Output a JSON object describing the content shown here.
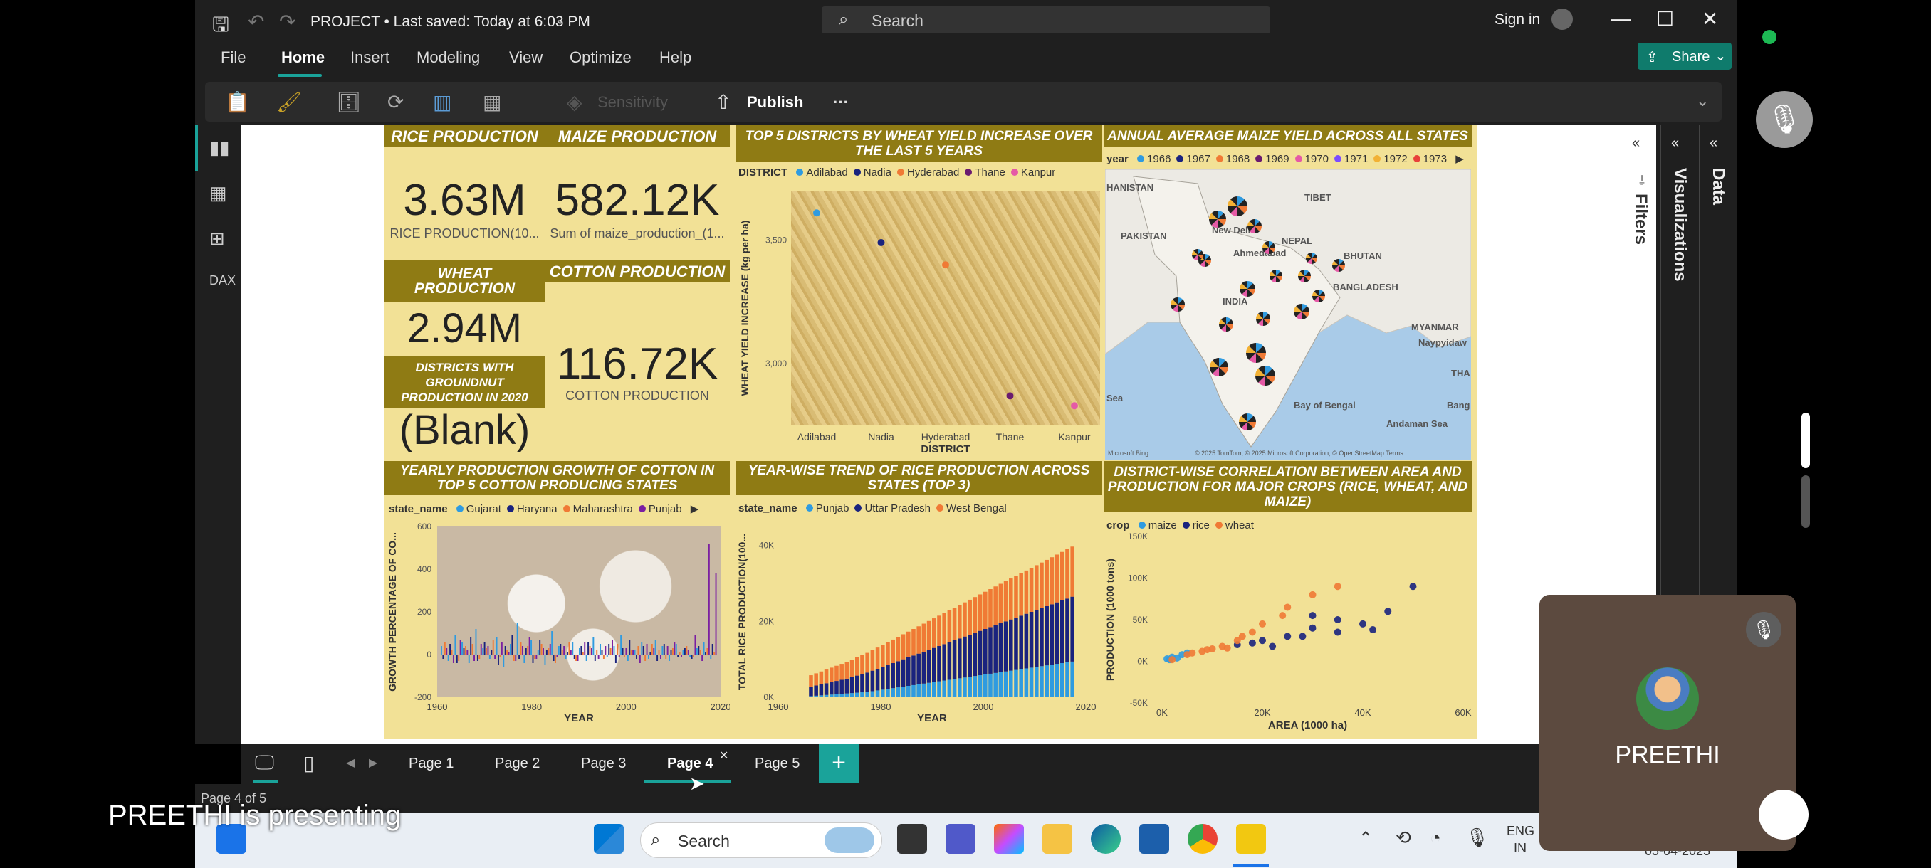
{
  "window": {
    "title": "PROJECT • Last saved: Today at 6:03 PM",
    "search_placeholder": "Search",
    "sign_in": "Sign in"
  },
  "menu": [
    "File",
    "Home",
    "Insert",
    "Modeling",
    "View",
    "Optimize",
    "Help"
  ],
  "share_label": "Share",
  "ribbon": {
    "sensitivity": "Sensitivity",
    "publish": "Publish",
    "more": "···"
  },
  "side_panes": {
    "filters": "Filters",
    "visualizations": "Visualizations",
    "data": "Data"
  },
  "cards": {
    "rice": {
      "title": "RICE PRODUCTION",
      "value": "3.63M",
      "label": "RICE PRODUCTION(10..."
    },
    "maize": {
      "title": "MAIZE PRODUCTION",
      "value": "582.12K",
      "label": "Sum of maize_production_(1..."
    },
    "wheat": {
      "title": "WHEAT PRODUCTION",
      "value": "2.94M"
    },
    "cotton": {
      "title": "COTTON PRODUCTION",
      "value": "116.72K",
      "label": "COTTON PRODUCTION"
    },
    "groundnut": {
      "title": "DISTRICTS WITH GROUNDNUT PRODUCTION IN 2020",
      "value": "(Blank)"
    }
  },
  "wheat_chart": {
    "title": "TOP 5 DISTRICTS BY WHEAT YIELD INCREASE OVER THE LAST 5 YEARS",
    "legend_title": "DISTRICT",
    "ylabel": "WHEAT YIELD INCREASE (kg per ha)",
    "xlabel": "DISTRICT"
  },
  "map_visual": {
    "title": "ANNUAL AVERAGE MAIZE YIELD ACROSS ALL STATES",
    "legend_title": "year",
    "years": [
      "1966",
      "1967",
      "1968",
      "1969",
      "1970",
      "1971",
      "1972",
      "1973"
    ],
    "year_colors": [
      "#2f9be0",
      "#1a237e",
      "#f07a35",
      "#6a1b6f",
      "#e55aa6",
      "#7c4dff",
      "#f2b134",
      "#e8413a"
    ],
    "labels": [
      "HANISTAN",
      "PAKISTAN",
      "New Delhi",
      "NEPAL",
      "BHUTAN",
      "BANGLADESH",
      "INDIA",
      "MYANMAR",
      "Naypyidaw",
      "THA",
      "Bay of Bengal",
      "Bang",
      "Andaman Sea",
      "Sea",
      "TIBET",
      "Ahmedabad"
    ],
    "attribution": "© 2025 TomTom, © 2025 Microsoft Corporation, © OpenStreetMap  Terms",
    "brand": "Microsoft Bing"
  },
  "cotton_chart": {
    "title": "YEARLY PRODUCTION GROWTH OF COTTON IN TOP 5 COTTON PRODUCING STATES",
    "legend_title": "state_name",
    "ylabel": "GROWTH PERCENTAGE OF CO...",
    "xlabel": "YEAR"
  },
  "rice_chart": {
    "title": "YEAR-WISE TREND OF RICE PRODUCTION ACROSS STATES (TOP 3)",
    "legend_title": "state_name",
    "ylabel": "TOTAL RICE PRODUCTION(100...",
    "xlabel": "YEAR"
  },
  "scatter_chart": {
    "title": "DISTRICT-WISE CORRELATION BETWEEN AREA AND PRODUCTION FOR MAJOR CROPS (RICE, WHEAT, AND MAIZE)",
    "legend_title": "crop",
    "ylabel": "PRODUCTION (1000 tons)",
    "xlabel": "AREA (1000 ha)"
  },
  "chart_data": [
    {
      "type": "scatter",
      "title": "TOP 5 DISTRICTS BY WHEAT YIELD INCREASE OVER THE LAST 5 YEARS",
      "xlabel": "DISTRICT",
      "ylabel": "WHEAT YIELD INCREASE (kg per ha)",
      "categories": [
        "Adilabad",
        "Nadia",
        "Hyderabad",
        "Thane",
        "Kanpur"
      ],
      "values": [
        3610,
        3490,
        3400,
        2870,
        2830
      ],
      "colors": [
        "#2f9be0",
        "#1a237e",
        "#f07a35",
        "#6a1b6f",
        "#e55aa6"
      ],
      "y_ticks": [
        "3,000",
        "3,500"
      ],
      "ylim": [
        2750,
        3700
      ]
    },
    {
      "type": "bar",
      "title": "YEARLY PRODUCTION GROWTH OF COTTON IN TOP 5 COTTON PRODUCING STATES",
      "xlabel": "YEAR",
      "ylabel": "GROWTH PERCENTAGE OF CO...",
      "series": [
        {
          "name": "Gujarat",
          "color": "#2f9be0",
          "values": [
            40,
            -30,
            90,
            60,
            -40,
            120,
            30,
            -20,
            80,
            -60,
            50,
            150,
            -40,
            70,
            20,
            -50,
            110,
            40,
            -20,
            60,
            30,
            -30,
            80,
            50,
            -10,
            40,
            90,
            -30,
            20,
            60,
            -20,
            70,
            40,
            -30,
            50,
            20,
            -10,
            30,
            60,
            -20
          ]
        },
        {
          "name": "Haryana",
          "color": "#1a237e",
          "values": [
            -20,
            50,
            -40,
            30,
            80,
            -30,
            60,
            20,
            -50,
            40,
            90,
            -20,
            30,
            -40,
            70,
            20,
            -30,
            50,
            10,
            -20,
            40,
            60,
            -30,
            20,
            50,
            -40,
            30,
            70,
            -20,
            40,
            10,
            -30,
            50,
            20,
            -10,
            30,
            -20,
            40,
            10,
            50
          ]
        },
        {
          "name": "Maharashtra",
          "color": "#f07a35",
          "values": [
            60,
            20,
            -30,
            40,
            50,
            -20,
            30,
            70,
            -10,
            20,
            -30,
            60,
            40,
            -20,
            50,
            30,
            -40,
            20,
            60,
            -30,
            10,
            40,
            20,
            -20,
            30,
            50,
            -10,
            20,
            40,
            -30,
            50,
            20,
            -20,
            30,
            10,
            40,
            -10,
            20,
            30,
            10
          ]
        },
        {
          "name": "Punjab",
          "color": "#7b1fa2",
          "values": [
            30,
            -40,
            70,
            20,
            -30,
            50,
            40,
            -20,
            60,
            10,
            -30,
            40,
            80,
            -20,
            30,
            50,
            -10,
            40,
            20,
            -30,
            60,
            30,
            -20,
            40,
            70,
            -10,
            30,
            20,
            -40,
            50,
            30,
            -20,
            40,
            60,
            -10,
            20,
            90,
            -30,
            520,
            380
          ]
        }
      ],
      "x_ticks": [
        "1960",
        "1980",
        "2000",
        "2020"
      ],
      "y_ticks": [
        "-200",
        "0",
        "200",
        "400",
        "600"
      ],
      "ylim": [
        -200,
        600
      ],
      "xlim": [
        1960,
        2020
      ]
    },
    {
      "type": "bar",
      "title": "YEAR-WISE TREND OF RICE PRODUCTION ACROSS STATES (TOP 3)",
      "xlabel": "YEAR",
      "ylabel": "TOTAL RICE PRODUCTION(100...",
      "categories_range": [
        1966,
        2017
      ],
      "series": [
        {
          "name": "Punjab",
          "color": "#2f9be0",
          "values": [
            300,
            400,
            500,
            600,
            700,
            800,
            900,
            1000,
            1100,
            1200,
            1300,
            1400,
            1600,
            1800,
            2000,
            2200,
            2400,
            2600,
            2800,
            3000,
            3200,
            3400,
            3600,
            3800,
            4000,
            4200,
            4400,
            4600,
            4800,
            5000,
            5200,
            5400,
            5600,
            5800,
            6000,
            6200,
            6400,
            6600,
            6800,
            7000,
            7200,
            7400,
            7600,
            7800,
            8000,
            8200,
            8400,
            8600,
            8800,
            9000,
            9200,
            9400
          ]
        },
        {
          "name": "Uttar Pradesh",
          "color": "#1a237e",
          "values": [
            2500,
            2700,
            2900,
            3100,
            3300,
            3500,
            3700,
            3900,
            4200,
            4500,
            4800,
            5100,
            5400,
            5700,
            6000,
            6300,
            6600,
            6900,
            7200,
            7500,
            7800,
            8100,
            8400,
            8700,
            9000,
            9300,
            9600,
            9900,
            10200,
            10500,
            10800,
            11100,
            11400,
            11700,
            12000,
            12300,
            12600,
            12900,
            13200,
            13500,
            13800,
            14100,
            14400,
            14700,
            15000,
            15300,
            15600,
            15900,
            16200,
            16500,
            16800,
            17100
          ]
        },
        {
          "name": "West Bengal",
          "color": "#f07a35",
          "values": [
            3000,
            3200,
            3400,
            3600,
            3800,
            4000,
            4200,
            4400,
            4600,
            4800,
            5000,
            5200,
            5400,
            5600,
            5800,
            6000,
            6200,
            6400,
            6600,
            6800,
            7000,
            7200,
            7400,
            7600,
            7800,
            8000,
            8200,
            8400,
            8600,
            8800,
            9000,
            9200,
            9400,
            9600,
            9800,
            10000,
            10200,
            10400,
            10600,
            10800,
            11000,
            11200,
            11400,
            11600,
            11800,
            12000,
            12200,
            12400,
            12600,
            12800,
            13000,
            13200
          ]
        }
      ],
      "x_ticks": [
        "1960",
        "1980",
        "2000",
        "2020"
      ],
      "y_ticks": [
        "0K",
        "20K",
        "40K"
      ],
      "ylim": [
        0,
        45000
      ],
      "xlim": [
        1960,
        2020
      ]
    },
    {
      "type": "scatter",
      "title": "DISTRICT-WISE CORRELATION BETWEEN AREA AND PRODUCTION FOR MAJOR CROPS (RICE, WHEAT, AND MAIZE)",
      "xlabel": "AREA (1000 ha)",
      "ylabel": "PRODUCTION (1000 tons)",
      "x_ticks": [
        "0K",
        "20K",
        "40K",
        "60K"
      ],
      "y_ticks": [
        "-50K",
        "0K",
        "50K",
        "100K",
        "150K"
      ],
      "xlim": [
        0,
        60000
      ],
      "ylim": [
        -50000,
        150000
      ],
      "series": [
        {
          "name": "maize",
          "color": "#2f9be0",
          "points": [
            [
              1000,
              3000
            ],
            [
              2000,
              5000
            ],
            [
              3000,
              4000
            ],
            [
              4000,
              8000
            ],
            [
              1500,
              2000
            ],
            [
              5000,
              10000
            ]
          ]
        },
        {
          "name": "rice",
          "color": "#1a237e",
          "points": [
            [
              15000,
              20000
            ],
            [
              20000,
              25000
            ],
            [
              25000,
              30000
            ],
            [
              30000,
              40000
            ],
            [
              35000,
              35000
            ],
            [
              40000,
              45000
            ],
            [
              45000,
              60000
            ],
            [
              50000,
              90000
            ],
            [
              30000,
              55000
            ],
            [
              35000,
              50000
            ],
            [
              42000,
              38000
            ],
            [
              28000,
              30000
            ],
            [
              22000,
              18000
            ],
            [
              18000,
              22000
            ]
          ]
        },
        {
          "name": "wheat",
          "color": "#f07a35",
          "points": [
            [
              2000,
              2000
            ],
            [
              5000,
              8000
            ],
            [
              8000,
              12000
            ],
            [
              10000,
              15000
            ],
            [
              12000,
              18000
            ],
            [
              15000,
              25000
            ],
            [
              18000,
              35000
            ],
            [
              20000,
              45000
            ],
            [
              25000,
              65000
            ],
            [
              30000,
              80000
            ],
            [
              35000,
              90000
            ],
            [
              24000,
              55000
            ],
            [
              16000,
              30000
            ],
            [
              6000,
              10000
            ],
            [
              9000,
              14000
            ],
            [
              13000,
              16000
            ]
          ]
        }
      ]
    }
  ],
  "pages": [
    "Page 1",
    "Page 2",
    "Page 3",
    "Page 4",
    "Page 5"
  ],
  "active_page": "Page 4",
  "status": "Page 4 of 5",
  "taskbar": {
    "search": "Search",
    "lang": "ENG",
    "region": "IN",
    "date": "05-04-2025"
  },
  "presenter": {
    "name": "PREETHI",
    "banner": "PREETHI is presenting"
  }
}
